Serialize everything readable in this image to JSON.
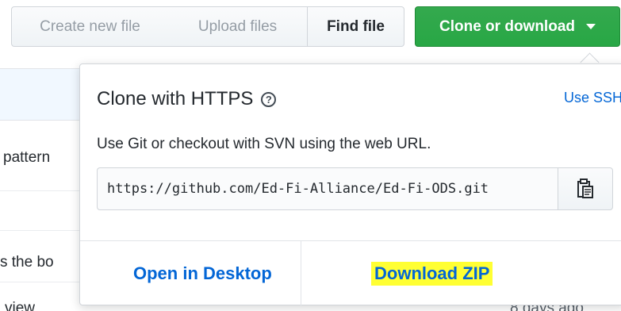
{
  "toolbar": {
    "create_label": "Create new file",
    "upload_label": "Upload files",
    "find_label": "Find file",
    "clone_label": "Clone or download"
  },
  "background": {
    "line1": "pattern",
    "line2": "s the bo",
    "line3": "view",
    "line4": "8 days ago"
  },
  "clone": {
    "title": "Clone with HTTPS",
    "help_icon": "question-circle-icon",
    "use_ssh": "Use SSH",
    "description": "Use Git or checkout with SVN using the web URL.",
    "url": "https://github.com/Ed-Fi-Alliance/Ed-Fi-ODS.git",
    "copy_icon": "clipboard-icon",
    "open_desktop": "Open in Desktop",
    "download_zip": "Download ZIP"
  },
  "colors": {
    "clone_button": "#28a745",
    "link": "#0366d6",
    "highlight": "#ffff33"
  }
}
